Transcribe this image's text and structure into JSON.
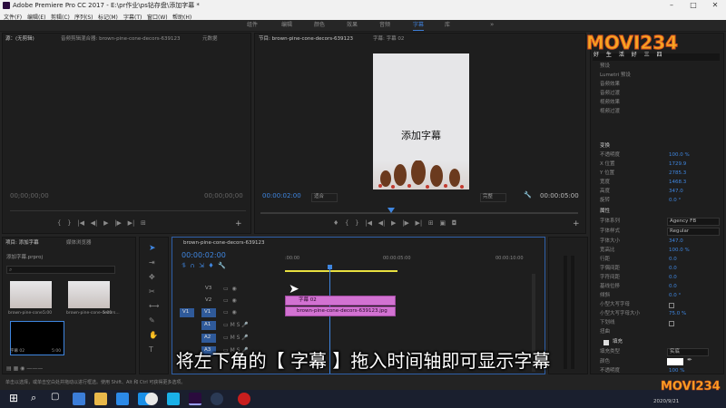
{
  "window": {
    "title": "Adobe Premiere Pro CC 2017 - E:\\pr作业\\ps钻存盘\\添加字幕 *"
  },
  "menu": [
    "文件(F)",
    "编辑(E)",
    "剪辑(C)",
    "序列(S)",
    "标记(M)",
    "字幕(T)",
    "窗口(W)",
    "帮助(H)"
  ],
  "workspaces": [
    "组件",
    "编辑",
    "颜色",
    "效果",
    "音频",
    "字幕",
    "库"
  ],
  "active_workspace": "字幕",
  "source_panel": {
    "tab_source": "源：(无剪辑)",
    "tab_audio": "音频剪辑混合器: brown-pine-cone-decors-639123",
    "tab_meta": "元数据",
    "timecode_left": "00;00;00;00",
    "timecode_right": "00;00;00;00"
  },
  "program_panel": {
    "tab_program": "节目: brown-pine-cone-decors-639123",
    "tab_title": "字幕: 字幕 02",
    "caption": "添加字幕",
    "timecode": "00:00:02:00",
    "fit": "适合",
    "quality": "完整",
    "duration": "00:00:05:00"
  },
  "project_panel": {
    "tab_project": "项目: 添加字幕",
    "tab_browser": "媒体浏览器",
    "file": "添加字幕.prproj",
    "items": [
      {
        "name": "brown-pine-cone...",
        "dur": "5:00"
      },
      {
        "name": "brown-pine-cone-decors...",
        "dur": "5:00"
      },
      {
        "name": "字幕 02",
        "dur": "5:00"
      }
    ]
  },
  "timeline": {
    "tab": "brown-pine-cone-decors-639123",
    "timecode": "00:00:02:00",
    "ruler": [
      ":00:00",
      "00:00:05:00",
      "00:00:10:00"
    ],
    "tracks_video": [
      "V3",
      "V2",
      "V1"
    ],
    "tracks_audio": [
      "A1",
      "A2",
      "A3"
    ],
    "clips": [
      {
        "name": "字幕 02"
      },
      {
        "name": "brown-pine-cone-decors-639123.jpg"
      }
    ]
  },
  "effects_tree": [
    "预设",
    "Lumetri 预设",
    "音频效果",
    "音频过渡",
    "视频效果",
    "视频过渡"
  ],
  "effect_controls": {
    "transform": "变换",
    "props": [
      {
        "label": "不透明度",
        "value": "100.0 %"
      },
      {
        "label": "X 位置",
        "value": "1729.9"
      },
      {
        "label": "Y 位置",
        "value": "2785.3"
      },
      {
        "label": "宽度",
        "value": "1468.3"
      },
      {
        "label": "高度",
        "value": "347.0"
      },
      {
        "label": "旋转",
        "value": "0.0 °"
      }
    ],
    "attributes": "属性",
    "attr": [
      {
        "label": "字体系列",
        "value": "Agency FB"
      },
      {
        "label": "字体样式",
        "value": "Regular"
      },
      {
        "label": "字体大小",
        "value": "347.0"
      },
      {
        "label": "宽高比",
        "value": "100.0 %"
      },
      {
        "label": "行距",
        "value": "0.0"
      },
      {
        "label": "字偶间距",
        "value": "0.0"
      },
      {
        "label": "字符间距",
        "value": "0.0"
      },
      {
        "label": "基线位移",
        "value": "0.0"
      },
      {
        "label": "倾斜",
        "value": "0.0 °"
      },
      {
        "label": "小型大写字母",
        "value": ""
      },
      {
        "label": "小型大写字母大小",
        "value": "75.0 %"
      },
      {
        "label": "下划线",
        "value": ""
      },
      {
        "label": "扭曲",
        "value": ""
      }
    ],
    "fill": "填充",
    "fill_type_label": "填充类型",
    "fill_type": "实底",
    "color_label": "颜色",
    "opacity_label": "不透明度",
    "opacity": "100 %"
  },
  "subtitle": "将左下角的【 字幕 】拖入时间轴即可显示字幕",
  "status": "单击以选择，或单击空白处并拖动以进行框选。使用 Shift、Alt 和 Ctrl 可获得更多选项。",
  "watermark": {
    "logo": "MOVI234",
    "tag": "好 生 活 好 三 四"
  },
  "clock": "2020/9/21",
  "colors": {
    "accent_blue": "#3f86e0",
    "clip_pink": "#d272d2",
    "yellow_bar": "#e8e040"
  }
}
